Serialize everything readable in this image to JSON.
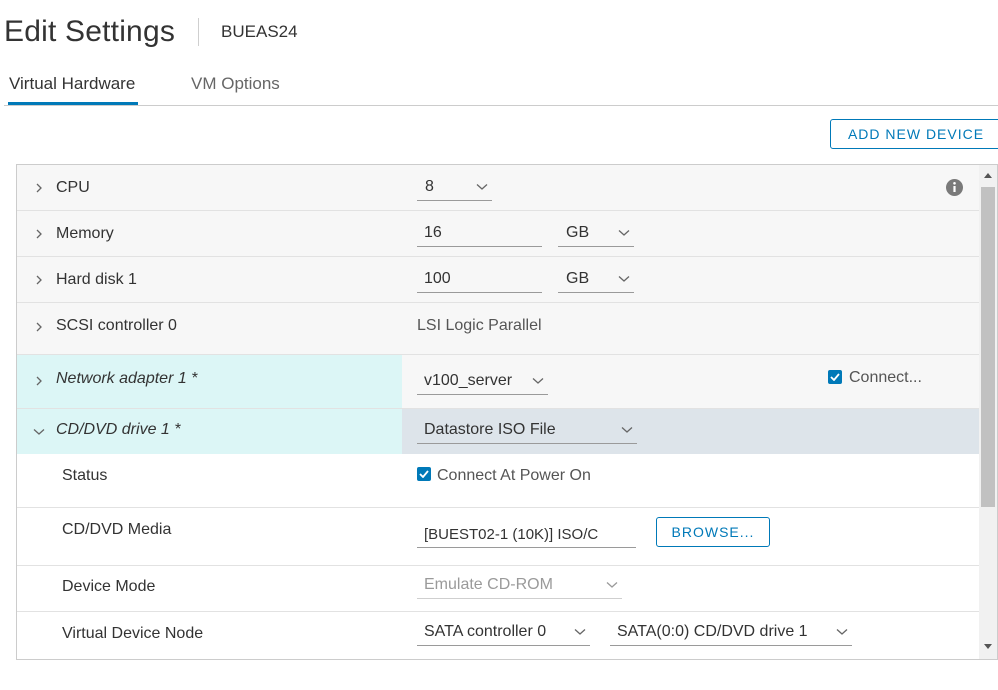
{
  "header": {
    "title": "Edit Settings",
    "vm_name": "BUEAS24"
  },
  "tabs": [
    {
      "label": "Virtual Hardware",
      "active": true
    },
    {
      "label": "VM Options",
      "active": false
    }
  ],
  "toolbar": {
    "add_device_label": "ADD NEW DEVICE"
  },
  "hardware": {
    "cpu": {
      "label": "CPU",
      "value": "8"
    },
    "memory": {
      "label": "Memory",
      "value": "16",
      "unit": "GB"
    },
    "hard_disk": {
      "label": "Hard disk 1",
      "value": "100",
      "unit": "GB"
    },
    "scsi": {
      "label": "SCSI controller 0",
      "value": "LSI Logic Parallel"
    },
    "network": {
      "label": "Network adapter 1 *",
      "network": "v100_server",
      "connect_label": "Connect...",
      "connected": true
    },
    "cddvd": {
      "label": "CD/DVD drive 1 *",
      "type": "Datastore ISO File",
      "status_label": "Status",
      "status_check_label": "Connect At Power On",
      "status_checked": true,
      "media_label": "CD/DVD Media",
      "media_value": "[BUEST02-1 (10K)] ISO/C",
      "browse_label": "BROWSE...",
      "device_mode_label": "Device Mode",
      "device_mode_value": "Emulate CD-ROM",
      "vdn_label": "Virtual Device Node",
      "vdn_controller": "SATA controller 0",
      "vdn_node": "SATA(0:0) CD/DVD drive 1"
    }
  },
  "colors": {
    "accent": "#0079b8",
    "highlight_cyan": "#dcf6f6",
    "highlight_gray": "#dde4ea"
  },
  "icons": {
    "info": "info-icon",
    "expand": "chevron-right-icon",
    "collapse": "chevron-down-icon",
    "dropdown": "chevron-down-icon"
  }
}
